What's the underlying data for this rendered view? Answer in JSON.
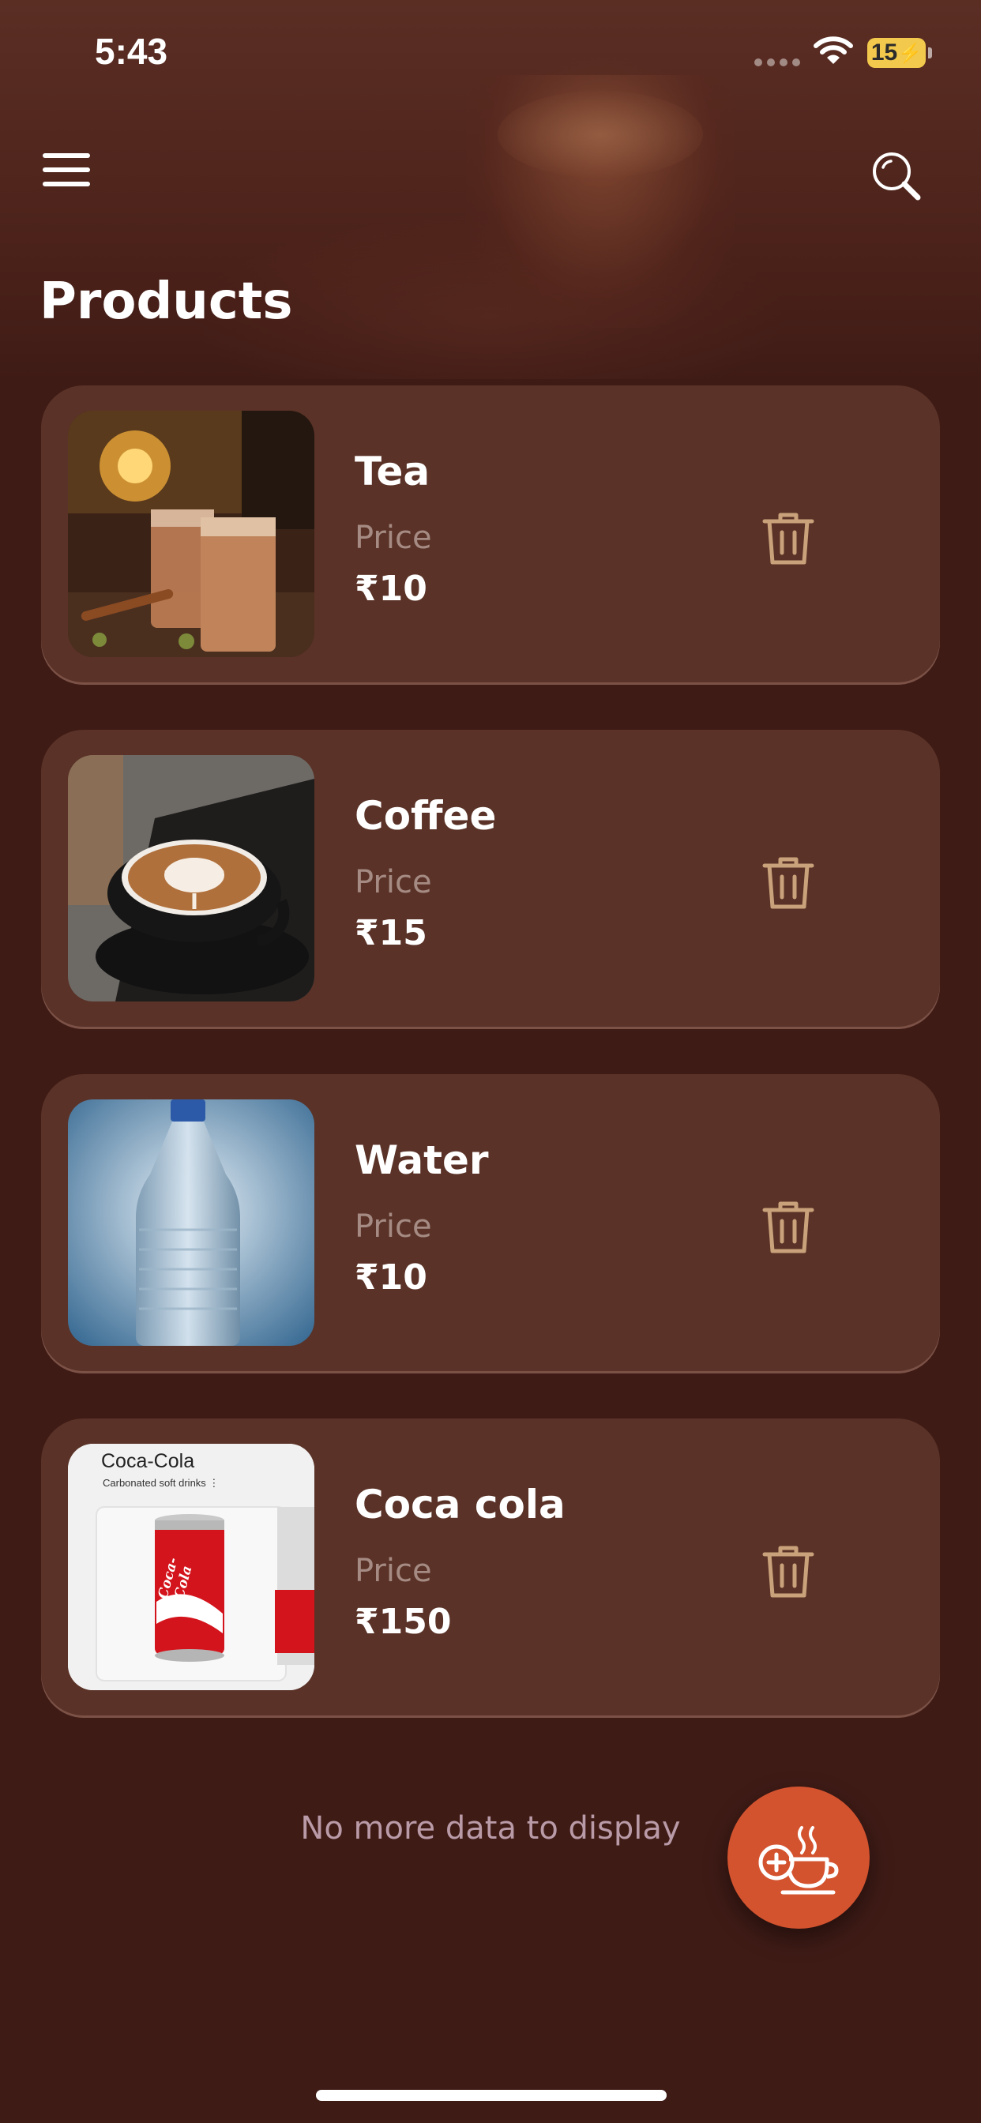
{
  "status_bar": {
    "time": "5:43",
    "battery": "15"
  },
  "header": {
    "title": "Products"
  },
  "products": [
    {
      "name": "Tea",
      "price_label": "Price",
      "price": "₹10",
      "image": "tea-glasses-photo"
    },
    {
      "name": "Coffee",
      "price_label": "Price",
      "price": "₹15",
      "image": "coffee-latte-photo"
    },
    {
      "name": "Water",
      "price_label": "Price",
      "price": "₹10",
      "image": "water-bottle-photo"
    },
    {
      "name": "Coca cola",
      "price_label": "Price",
      "price": "₹150",
      "image": "coca-cola-can-photo",
      "image_caption": "Coca-Cola",
      "image_subcaption": "Carbonated soft drinks ⋮",
      "can_text": "Coca-Cola"
    }
  ],
  "footer": {
    "end_message": "No more data to display"
  },
  "colors": {
    "background": "#3f1b16",
    "card": "#5a3227",
    "accent": "#d4532f",
    "icon_tan": "#c9a17a",
    "muted_text": "#a58b83"
  },
  "icons": [
    "menu-icon",
    "search-icon",
    "trash-icon",
    "add-cup-icon",
    "wifi-icon",
    "battery-icon"
  ]
}
